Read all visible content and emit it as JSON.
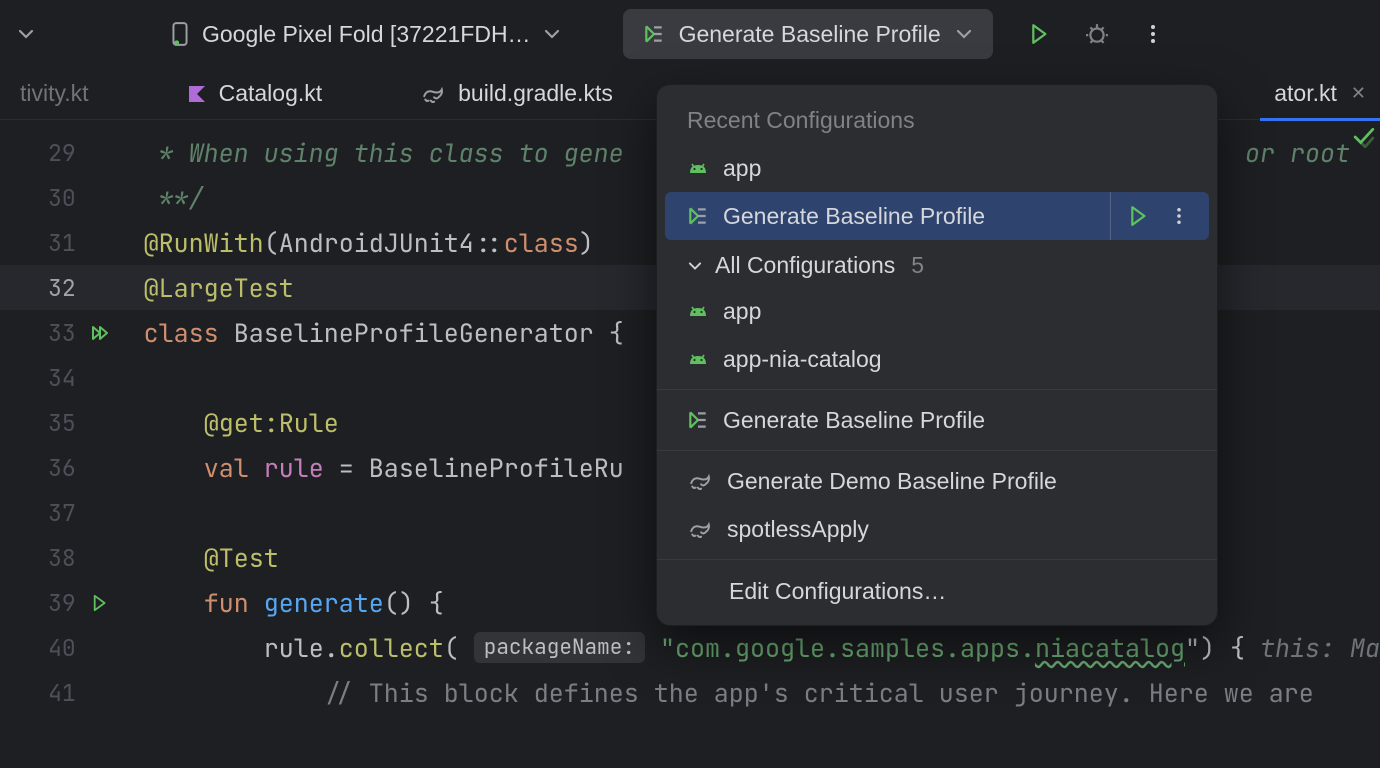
{
  "toolbar": {
    "device_label": "Google Pixel Fold [37221FDH…",
    "run_config_label": "Generate Baseline Profile"
  },
  "tabs": {
    "t0": "tivity.kt",
    "t1": "Catalog.kt",
    "t2": "build.gradle.kts",
    "t3": "ator.kt"
  },
  "editor": {
    "gutter": [
      "29",
      "30",
      "31",
      "32",
      "33",
      "34",
      "35",
      "36",
      "37",
      "38",
      "39",
      "40",
      "41"
    ],
    "l29": " * When using this class to gene",
    "l29b": "or root",
    "l30": " **/",
    "l31_a": "@RunWith",
    "l31_b": "(AndroidJUnit4::",
    "l31_c": "class",
    "l31_d": ")",
    "l32": "@LargeTest",
    "l33_a": "class",
    "l33_b": " BaselineProfileGenerator {",
    "l35": "@get:Rule",
    "l36_a": "val",
    "l36_b": " ",
    "l36_c": "rule",
    "l36_d": " = BaselineProfileRu",
    "l38": "@Test",
    "l39_a": "fun",
    "l39_b": " ",
    "l39_c": "generate",
    "l39_d": "() {",
    "l40_a": "rule.",
    "l40_b": "collect",
    "l40_c": "( ",
    "l40_pk": "packageName:",
    "l40_d": " \"com.google.samples.apps.",
    "l40_e": "niacatalog",
    "l40_f": "\") { ",
    "l40_g": "this: Ma",
    "l41": "// This block defines the app's critical user journey. Here we are"
  },
  "popup": {
    "recent_header": "Recent Configurations",
    "recent": {
      "r0": "app",
      "r1": "Generate Baseline Profile"
    },
    "all_header": "All Configurations",
    "all_count": "5",
    "all": {
      "a0": "app",
      "a1": "app-nia-catalog",
      "a2": "Generate Baseline Profile",
      "a3": "Generate Demo Baseline Profile",
      "a4": "spotlessApply"
    },
    "edit": "Edit Configurations…"
  }
}
